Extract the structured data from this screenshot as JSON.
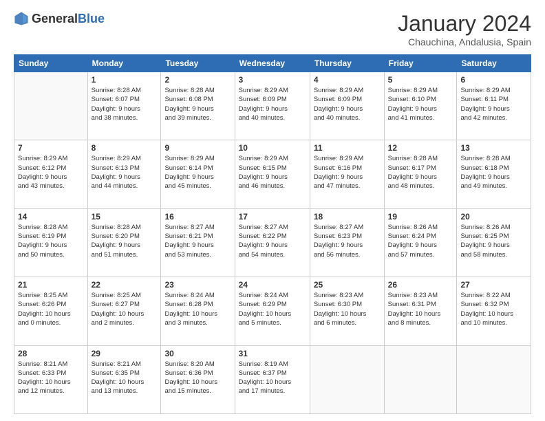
{
  "header": {
    "logo_general": "General",
    "logo_blue": "Blue",
    "month_title": "January 2024",
    "subtitle": "Chauchina, Andalusia, Spain"
  },
  "days_of_week": [
    "Sunday",
    "Monday",
    "Tuesday",
    "Wednesday",
    "Thursday",
    "Friday",
    "Saturday"
  ],
  "weeks": [
    [
      {
        "day": "",
        "info": ""
      },
      {
        "day": "1",
        "info": "Sunrise: 8:28 AM\nSunset: 6:07 PM\nDaylight: 9 hours\nand 38 minutes."
      },
      {
        "day": "2",
        "info": "Sunrise: 8:28 AM\nSunset: 6:08 PM\nDaylight: 9 hours\nand 39 minutes."
      },
      {
        "day": "3",
        "info": "Sunrise: 8:29 AM\nSunset: 6:09 PM\nDaylight: 9 hours\nand 40 minutes."
      },
      {
        "day": "4",
        "info": "Sunrise: 8:29 AM\nSunset: 6:09 PM\nDaylight: 9 hours\nand 40 minutes."
      },
      {
        "day": "5",
        "info": "Sunrise: 8:29 AM\nSunset: 6:10 PM\nDaylight: 9 hours\nand 41 minutes."
      },
      {
        "day": "6",
        "info": "Sunrise: 8:29 AM\nSunset: 6:11 PM\nDaylight: 9 hours\nand 42 minutes."
      }
    ],
    [
      {
        "day": "7",
        "info": "Sunrise: 8:29 AM\nSunset: 6:12 PM\nDaylight: 9 hours\nand 43 minutes."
      },
      {
        "day": "8",
        "info": "Sunrise: 8:29 AM\nSunset: 6:13 PM\nDaylight: 9 hours\nand 44 minutes."
      },
      {
        "day": "9",
        "info": "Sunrise: 8:29 AM\nSunset: 6:14 PM\nDaylight: 9 hours\nand 45 minutes."
      },
      {
        "day": "10",
        "info": "Sunrise: 8:29 AM\nSunset: 6:15 PM\nDaylight: 9 hours\nand 46 minutes."
      },
      {
        "day": "11",
        "info": "Sunrise: 8:29 AM\nSunset: 6:16 PM\nDaylight: 9 hours\nand 47 minutes."
      },
      {
        "day": "12",
        "info": "Sunrise: 8:28 AM\nSunset: 6:17 PM\nDaylight: 9 hours\nand 48 minutes."
      },
      {
        "day": "13",
        "info": "Sunrise: 8:28 AM\nSunset: 6:18 PM\nDaylight: 9 hours\nand 49 minutes."
      }
    ],
    [
      {
        "day": "14",
        "info": "Sunrise: 8:28 AM\nSunset: 6:19 PM\nDaylight: 9 hours\nand 50 minutes."
      },
      {
        "day": "15",
        "info": "Sunrise: 8:28 AM\nSunset: 6:20 PM\nDaylight: 9 hours\nand 51 minutes."
      },
      {
        "day": "16",
        "info": "Sunrise: 8:27 AM\nSunset: 6:21 PM\nDaylight: 9 hours\nand 53 minutes."
      },
      {
        "day": "17",
        "info": "Sunrise: 8:27 AM\nSunset: 6:22 PM\nDaylight: 9 hours\nand 54 minutes."
      },
      {
        "day": "18",
        "info": "Sunrise: 8:27 AM\nSunset: 6:23 PM\nDaylight: 9 hours\nand 56 minutes."
      },
      {
        "day": "19",
        "info": "Sunrise: 8:26 AM\nSunset: 6:24 PM\nDaylight: 9 hours\nand 57 minutes."
      },
      {
        "day": "20",
        "info": "Sunrise: 8:26 AM\nSunset: 6:25 PM\nDaylight: 9 hours\nand 58 minutes."
      }
    ],
    [
      {
        "day": "21",
        "info": "Sunrise: 8:25 AM\nSunset: 6:26 PM\nDaylight: 10 hours\nand 0 minutes."
      },
      {
        "day": "22",
        "info": "Sunrise: 8:25 AM\nSunset: 6:27 PM\nDaylight: 10 hours\nand 2 minutes."
      },
      {
        "day": "23",
        "info": "Sunrise: 8:24 AM\nSunset: 6:28 PM\nDaylight: 10 hours\nand 3 minutes."
      },
      {
        "day": "24",
        "info": "Sunrise: 8:24 AM\nSunset: 6:29 PM\nDaylight: 10 hours\nand 5 minutes."
      },
      {
        "day": "25",
        "info": "Sunrise: 8:23 AM\nSunset: 6:30 PM\nDaylight: 10 hours\nand 6 minutes."
      },
      {
        "day": "26",
        "info": "Sunrise: 8:23 AM\nSunset: 6:31 PM\nDaylight: 10 hours\nand 8 minutes."
      },
      {
        "day": "27",
        "info": "Sunrise: 8:22 AM\nSunset: 6:32 PM\nDaylight: 10 hours\nand 10 minutes."
      }
    ],
    [
      {
        "day": "28",
        "info": "Sunrise: 8:21 AM\nSunset: 6:33 PM\nDaylight: 10 hours\nand 12 minutes."
      },
      {
        "day": "29",
        "info": "Sunrise: 8:21 AM\nSunset: 6:35 PM\nDaylight: 10 hours\nand 13 minutes."
      },
      {
        "day": "30",
        "info": "Sunrise: 8:20 AM\nSunset: 6:36 PM\nDaylight: 10 hours\nand 15 minutes."
      },
      {
        "day": "31",
        "info": "Sunrise: 8:19 AM\nSunset: 6:37 PM\nDaylight: 10 hours\nand 17 minutes."
      },
      {
        "day": "",
        "info": ""
      },
      {
        "day": "",
        "info": ""
      },
      {
        "day": "",
        "info": ""
      }
    ]
  ]
}
